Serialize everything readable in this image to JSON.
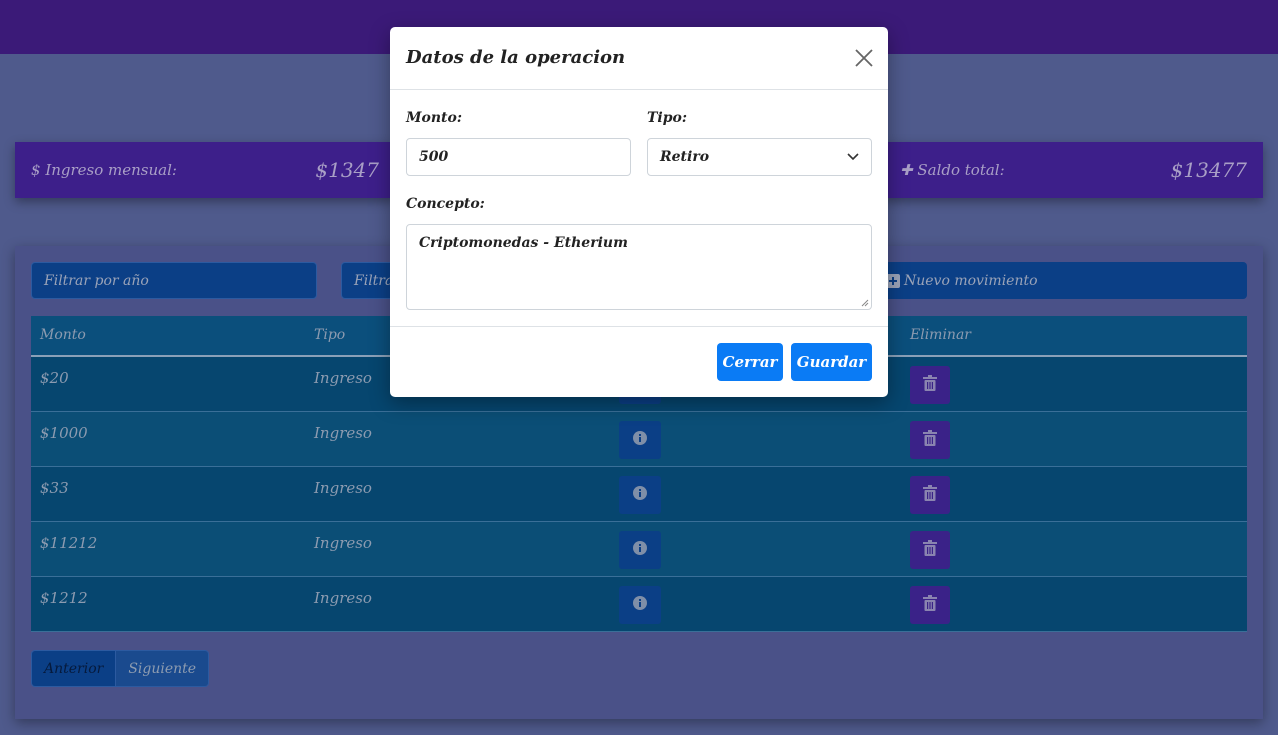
{
  "cards": {
    "ingreso_label": "Ingreso mensual:",
    "ingreso_amount": "$1347",
    "saldo_label": "Saldo total:",
    "saldo_amount": "$13477"
  },
  "filters": {
    "year_placeholder": "Filtrar por año",
    "other_placeholder": "Filtra",
    "new_button": "Nuevo movimiento"
  },
  "table": {
    "headers": [
      "Monto",
      "Tipo",
      "Eliminar"
    ],
    "rows": [
      {
        "monto": "$20",
        "tipo": "Ingreso"
      },
      {
        "monto": "$1000",
        "tipo": "Ingreso"
      },
      {
        "monto": "$33",
        "tipo": "Ingreso"
      },
      {
        "monto": "$11212",
        "tipo": "Ingreso"
      },
      {
        "monto": "$1212",
        "tipo": "Ingreso"
      }
    ]
  },
  "pager": {
    "prev": "Anterior",
    "next": "Siguiente"
  },
  "modal": {
    "title": "Datos de la operacion",
    "monto_label": "Monto:",
    "monto_value": "500",
    "tipo_label": "Tipo:",
    "tipo_value": "Retiro",
    "concepto_label": "Concepto:",
    "concepto_value": "Criptomonedas - Etherium",
    "cerrar": "Cerrar",
    "guardar": "Guardar"
  },
  "colors": {
    "topbar": "#3b1a78",
    "primary": "#0a7bf5",
    "delete": "#3a2288"
  }
}
